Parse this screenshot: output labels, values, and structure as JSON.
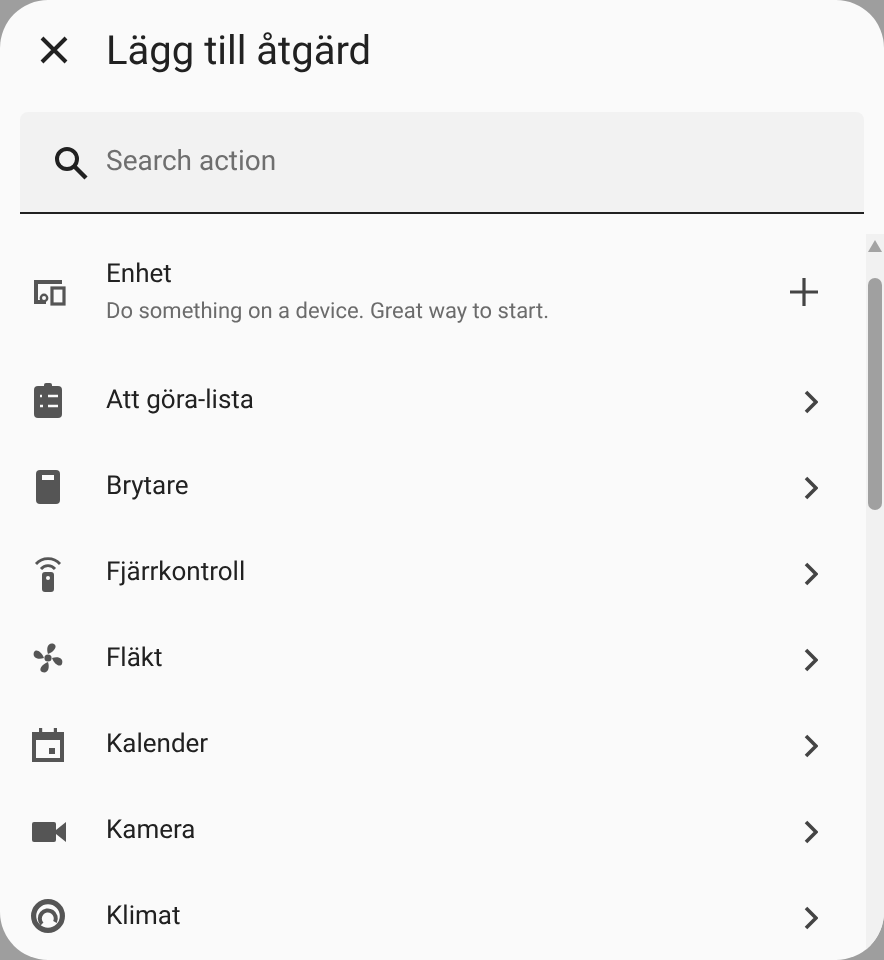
{
  "dialog": {
    "title": "Lägg till åtgärd"
  },
  "search": {
    "placeholder": "Search action"
  },
  "items": [
    {
      "kind": "add",
      "label": "Enhet",
      "description": "Do something on a device. Great way to start."
    },
    {
      "kind": "group",
      "label": "Att göra-lista"
    },
    {
      "kind": "group",
      "label": "Brytare"
    },
    {
      "kind": "group",
      "label": "Fjärrkontroll"
    },
    {
      "kind": "group",
      "label": "Fläkt"
    },
    {
      "kind": "group",
      "label": "Kalender"
    },
    {
      "kind": "group",
      "label": "Kamera"
    },
    {
      "kind": "group",
      "label": "Klimat"
    }
  ]
}
